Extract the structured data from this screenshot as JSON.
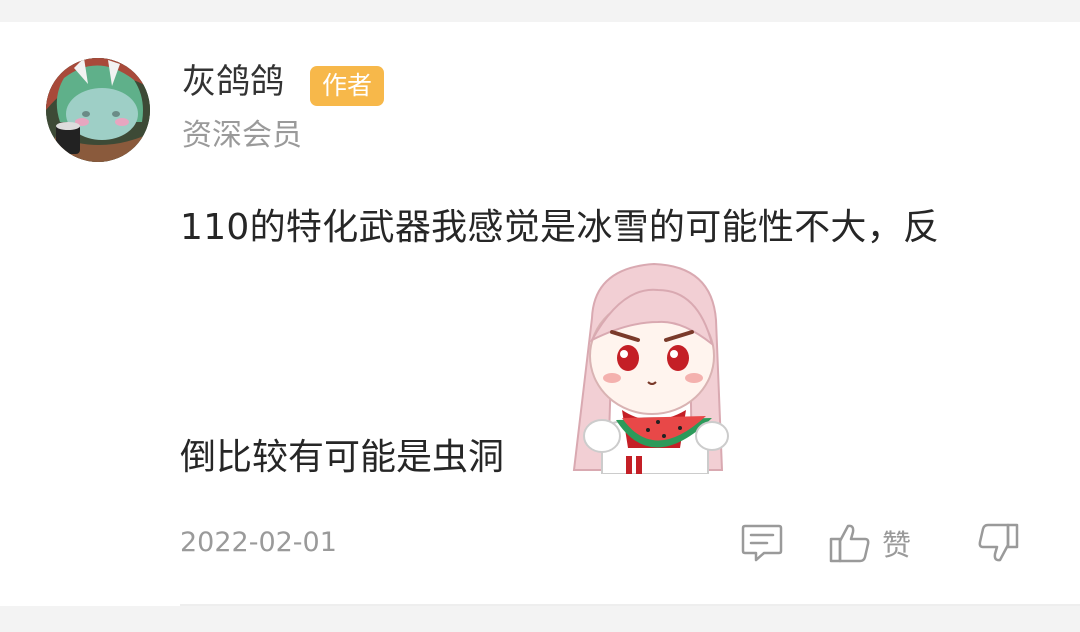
{
  "comment": {
    "author": {
      "name": "灰鸽鸽",
      "badge": "作者",
      "level": "资深会员",
      "avatar_icon": "anime-avatar-image"
    },
    "text_line_1": "110的特化武器我感觉是冰雪的可能性不大，反",
    "sticker_icon": "girl-eating-watermelon-sticker",
    "text_line_2": "倒比较有可能是虫洞",
    "date": "2022-02-01",
    "actions": {
      "reply_icon": "comment-icon",
      "like_icon": "thumbs-up-icon",
      "like_label": "赞",
      "dislike_icon": "thumbs-down-icon"
    }
  },
  "colors": {
    "badge": "#f7b84a",
    "text_primary": "#262626",
    "text_secondary": "#9a9a9a",
    "page_background": "#f3f3f3"
  }
}
